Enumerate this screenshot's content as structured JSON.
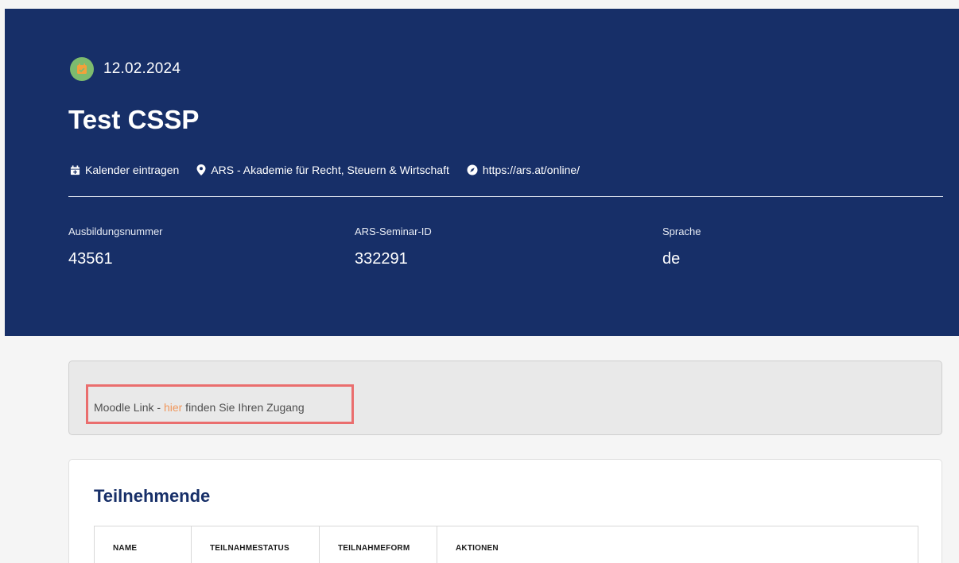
{
  "header": {
    "date": "12.02.2024",
    "title": "Test CSSP",
    "meta": {
      "calendar_label": "Kalender eintragen",
      "location": "ARS - Akademie für Recht, Steuern & Wirtschaft",
      "url": "https://ars.at/online/"
    },
    "info": [
      {
        "label": "Ausbildungsnummer",
        "value": "43561"
      },
      {
        "label": "ARS-Seminar-ID",
        "value": "332291"
      },
      {
        "label": "Sprache",
        "value": "de"
      }
    ]
  },
  "moodle": {
    "prefix": "Moodle Link - ",
    "link_text": "hier",
    "suffix": " finden Sie Ihren Zugang"
  },
  "participants": {
    "title": "Teilnehmende",
    "columns": [
      "NAME",
      "TEILNAHMESTATUS",
      "TEILNAHMEFORM",
      "AKTIONEN"
    ]
  },
  "colors": {
    "header_bg": "#172f68",
    "accent_link": "#f0975c",
    "calendar_badge": "#7dbb6e",
    "highlight_border": "#ea6e6e"
  },
  "icons": [
    "calendar-check-icon",
    "calendar-plus-icon",
    "map-marker-icon",
    "compass-icon"
  ]
}
